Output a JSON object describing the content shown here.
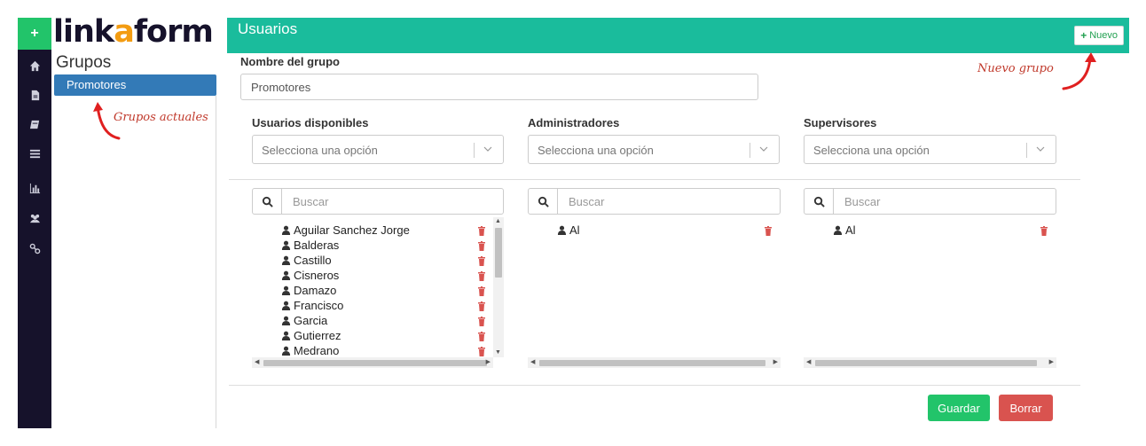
{
  "app": {
    "logo": {
      "left": "link",
      "mid": "a",
      "right": "form"
    },
    "header_title": "Usuarios",
    "new_button_label": "Nuevo"
  },
  "groups": {
    "title": "Grupos",
    "items": [
      {
        "label": "Promotores",
        "selected": true
      }
    ]
  },
  "annotations": {
    "groups_hint": "Grupos actuales",
    "new_hint": "Nuevo grupo"
  },
  "form": {
    "group_name_label": "Nombre del grupo",
    "group_name_value": "Promotores",
    "columns": [
      {
        "label": "Usuarios disponibles",
        "select_placeholder": "Selecciona una opción",
        "search_placeholder": "Buscar",
        "items": [
          "Aguilar Sanchez Jorge",
          "Balderas",
          "Castillo",
          "Cisneros",
          "Damazo",
          "Francisco",
          "Garcia",
          "Gutierrez",
          "Medrano"
        ]
      },
      {
        "label": "Administradores",
        "select_placeholder": "Selecciona una opción",
        "search_placeholder": "Buscar",
        "items": [
          "Al"
        ]
      },
      {
        "label": "Supervisores",
        "select_placeholder": "Selecciona una opción",
        "search_placeholder": "Buscar",
        "items": [
          "Al"
        ]
      }
    ],
    "save_label": "Guardar",
    "delete_label": "Borrar"
  },
  "sidebar_icons": [
    "home-icon",
    "file-icon",
    "book-icon",
    "list-icon",
    "bar-chart-icon",
    "users-icon",
    "link-icon"
  ],
  "colors": {
    "header": "#1abc9c",
    "rail": "#16122b",
    "primary": "#337ab7",
    "success": "#22c46a",
    "danger": "#d9534f",
    "annotation": "#c0392b"
  }
}
